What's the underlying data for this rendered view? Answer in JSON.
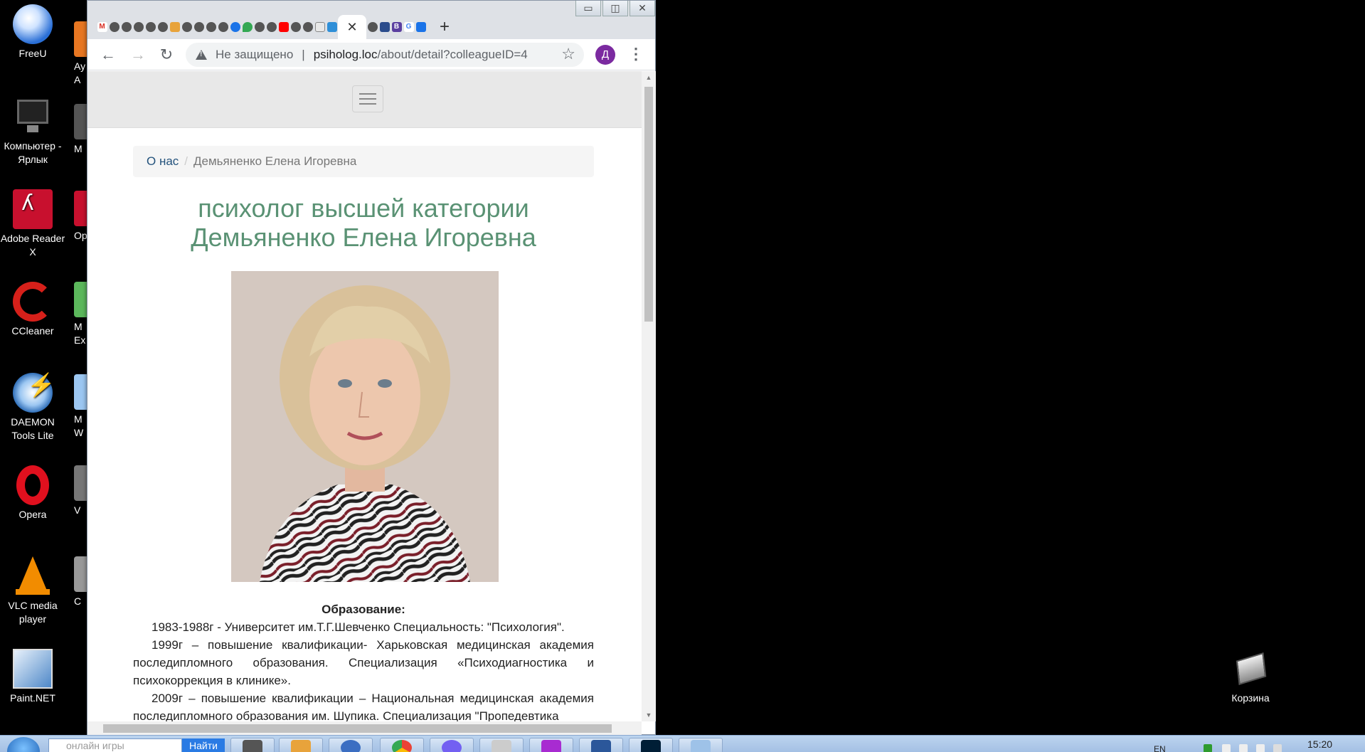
{
  "desktop": {
    "icons": [
      {
        "label": "FreeU"
      },
      {
        "label": "Компьютер - Ярлык"
      },
      {
        "label": "Adobe Reader X"
      },
      {
        "label": "CCleaner"
      },
      {
        "label": "DAEMON Tools Lite"
      },
      {
        "label": "Opera"
      },
      {
        "label": "VLC media player"
      },
      {
        "label": "Paint.NET"
      }
    ],
    "partial_labels": [
      "Ay A",
      "M",
      "Ope",
      "M Ex",
      "M W",
      "V",
      "C",
      ""
    ],
    "recycle_bin": "Корзина"
  },
  "browser": {
    "tab_close": "✕",
    "new_tab": "+",
    "back": "←",
    "forward": "→",
    "reload": "↻",
    "security_label": "Не защищено",
    "separator": "|",
    "url_host": "psiholog.loc",
    "url_path": "/about/detail?colleagueID=4",
    "bookmark_star": "☆",
    "profile_initial": "Д",
    "menu": "⋮",
    "window_controls": {
      "minimize": "▭",
      "maximize": "◫",
      "close": "✕"
    }
  },
  "page": {
    "breadcrumb": {
      "link": "О нас",
      "separator": "/",
      "current": "Демьяненко Елена Игоревна"
    },
    "title_line1": "психолог высшей категории",
    "title_line2": "Демьяненко Елена Игоревна",
    "education_heading": "Образование:",
    "education": [
      "1983-1988г - Университет им.Т.Г.Шевченко Специальность: \"Психология\".",
      "1999г – повышение квалификации- Харьковская медицинская академия последипломного образования. Специализация «Психодиагностика и психокоррекция в клинике».",
      "2009г – повышение квалификации – Национальная медицинская академия последипломного образования им. Шупика. Специализация \"Пропедевтика"
    ]
  },
  "taskbar": {
    "search_placeholder": "онлайн игры",
    "search_button": "Найти",
    "lang": "EN",
    "clock": "15:20"
  }
}
